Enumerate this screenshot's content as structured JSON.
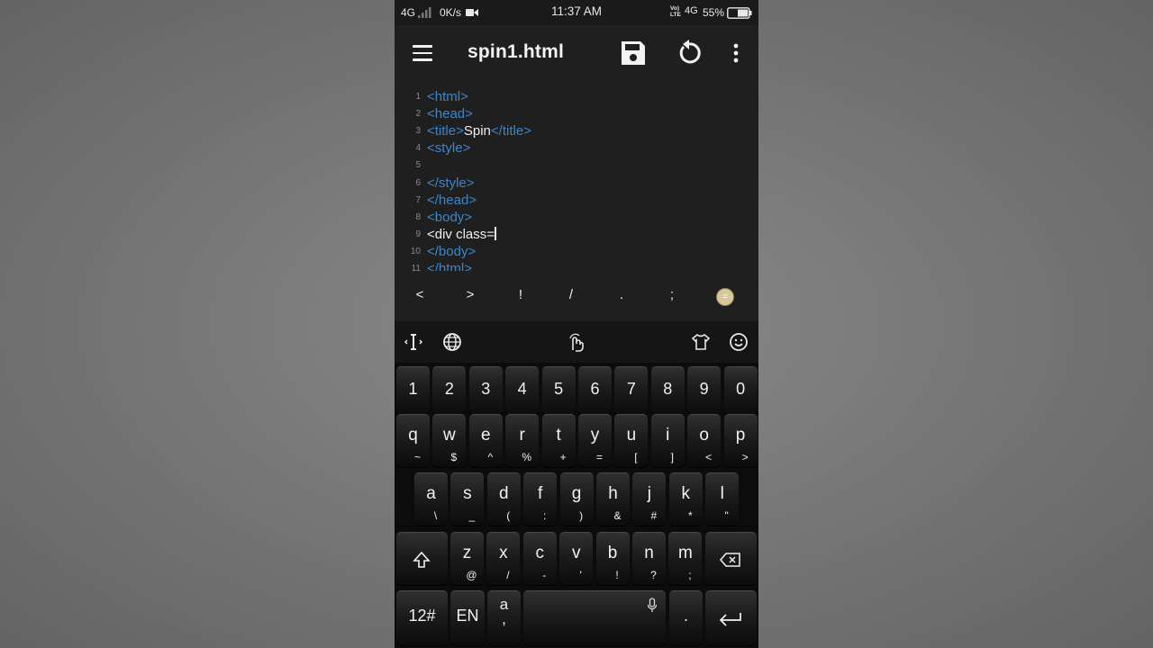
{
  "status_bar": {
    "network": "4G",
    "speed": "0K/s",
    "time": "11:37 AM",
    "volte_top": "Vo)",
    "volte_bottom": "LTE",
    "network2": "4G",
    "battery": "55%"
  },
  "toolbar": {
    "title": "spin1.html",
    "icons": [
      "menu-icon",
      "save-icon",
      "undo-icon",
      "more-vert-icon"
    ]
  },
  "editor": {
    "lines": [
      {
        "num": "1",
        "parts": [
          {
            "t": "<html>",
            "c": "tag"
          }
        ]
      },
      {
        "num": "2",
        "parts": [
          {
            "t": "<head>",
            "c": "tag"
          }
        ]
      },
      {
        "num": "3",
        "parts": [
          {
            "t": "<title>",
            "c": "tag"
          },
          {
            "t": "Spin",
            "c": "txt"
          },
          {
            "t": "</title>",
            "c": "tag"
          }
        ]
      },
      {
        "num": "4",
        "parts": [
          {
            "t": "<style>",
            "c": "tag"
          }
        ]
      },
      {
        "num": "5",
        "parts": []
      },
      {
        "num": "6",
        "parts": [
          {
            "t": "</style>",
            "c": "tag"
          }
        ]
      },
      {
        "num": "7",
        "parts": [
          {
            "t": "</head>",
            "c": "tag"
          }
        ]
      },
      {
        "num": "8",
        "parts": [
          {
            "t": "<body>",
            "c": "tag"
          }
        ]
      },
      {
        "num": "9",
        "parts": [
          {
            "t": "<div class=",
            "c": "txt"
          }
        ],
        "caret": true
      },
      {
        "num": "10",
        "parts": [
          {
            "t": "</body>",
            "c": "tag"
          }
        ]
      },
      {
        "num": "11",
        "parts": [
          {
            "t": "</html>",
            "c": "tag"
          }
        ]
      }
    ]
  },
  "symbol_bar": [
    "<",
    ">",
    "!",
    "/",
    ".",
    ";"
  ],
  "symbol_bar_active": "=",
  "keyboard": {
    "number_row": [
      "1",
      "2",
      "3",
      "4",
      "5",
      "6",
      "7",
      "8",
      "9",
      "0"
    ],
    "row1": [
      {
        "k": "q",
        "s": "~"
      },
      {
        "k": "w",
        "s": "$"
      },
      {
        "k": "e",
        "s": "^"
      },
      {
        "k": "r",
        "s": "%"
      },
      {
        "k": "t",
        "s": "+"
      },
      {
        "k": "y",
        "s": "="
      },
      {
        "k": "u",
        "s": "["
      },
      {
        "k": "i",
        "s": "]"
      },
      {
        "k": "o",
        "s": "<"
      },
      {
        "k": "p",
        "s": ">"
      }
    ],
    "row2": [
      {
        "k": "a",
        "s": "\\"
      },
      {
        "k": "s",
        "s": "_"
      },
      {
        "k": "d",
        "s": "("
      },
      {
        "k": "f",
        "s": ":"
      },
      {
        "k": "g",
        "s": ")"
      },
      {
        "k": "h",
        "s": "&"
      },
      {
        "k": "j",
        "s": "#"
      },
      {
        "k": "k",
        "s": "*"
      },
      {
        "k": "l",
        "s": "\""
      }
    ],
    "row3": [
      {
        "k": "z",
        "s": "@"
      },
      {
        "k": "x",
        "s": "/"
      },
      {
        "k": "c",
        "s": "-"
      },
      {
        "k": "v",
        "s": "'"
      },
      {
        "k": "b",
        "s": "!"
      },
      {
        "k": "n",
        "s": "?"
      },
      {
        "k": "m",
        "s": ";"
      }
    ],
    "symbols_key": "12#",
    "lang_key": "EN",
    "comma_key_main": "a",
    "comma_key_sub": ",",
    "period_key": ".",
    "toolbar_icons": [
      "text-cursor-icon",
      "globe-icon",
      "swipe-gesture-icon",
      "shirt-theme-icon",
      "emoji-icon"
    ]
  },
  "colors": {
    "tag": "#3f86c8",
    "text": "#f0f0f0",
    "editor_bg": "#1f1f1f",
    "keyboard_bg": "#0c0c0c"
  }
}
